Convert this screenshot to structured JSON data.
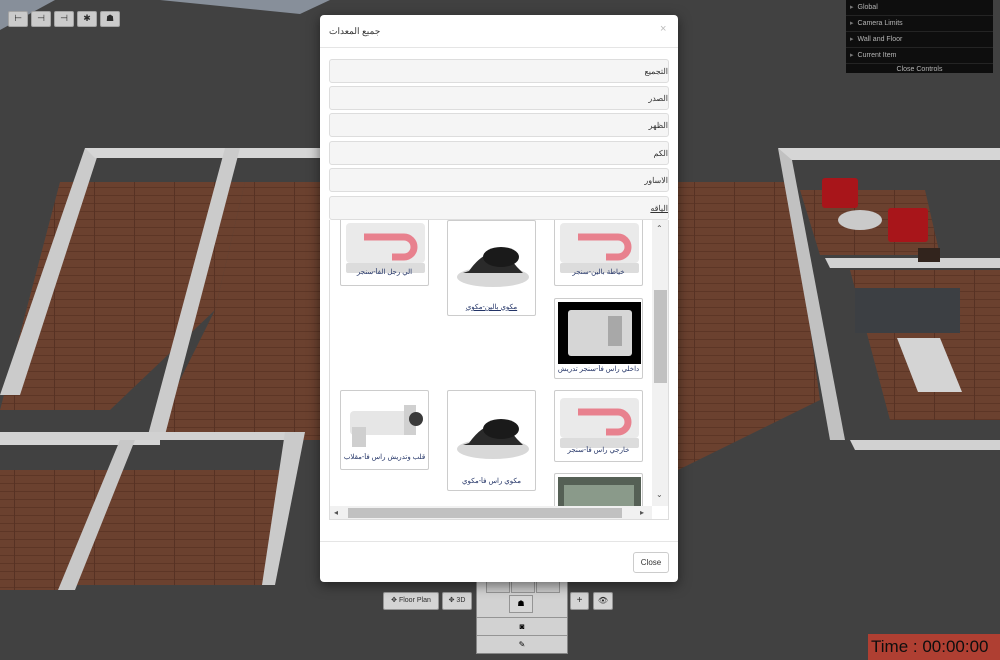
{
  "toolbar": {
    "tools": [
      {
        "glyph": "⊢"
      },
      {
        "glyph": "⊣"
      },
      {
        "glyph": "⊣"
      },
      {
        "glyph": "✱"
      },
      {
        "glyph": "☗"
      }
    ]
  },
  "controls": {
    "items": [
      "Global",
      "Camera Limits",
      "Wall and Floor",
      "Current Item"
    ],
    "close_label": "Close Controls"
  },
  "bottom_bar": {
    "floor_plan_label": "✥ Floor Plan",
    "view_3d_label": "✥ 3D",
    "zoom_in_glyph": "+",
    "eye_glyph": "👁"
  },
  "timer": {
    "text": "Time : 00:00:00"
  },
  "modal": {
    "title": "جميع المعدات",
    "close_x": "×",
    "sections": [
      "التجميع",
      "الصدر",
      "الظهر",
      "الكم",
      "الاساور",
      "الياقه"
    ],
    "items": [
      {
        "caption": "خياطة بالين-سنجر"
      },
      {
        "caption": "مكوي بالين-مكوي"
      },
      {
        "caption": "الي رجل الفأ-سنجر"
      },
      {
        "caption": "داخلي راس فأ-سنجر تدريش"
      },
      {
        "caption": "خارجي راس فأ-سنجر"
      },
      {
        "caption": "مكوي راس فأ-مكوي"
      },
      {
        "caption": "قلب وتدريش راس فأ-مقلاب"
      },
      {
        "caption": ""
      }
    ],
    "close_button_label": "Close"
  },
  "colors": {
    "accent_pink": "#e8818e",
    "timer_red": "#c8483a",
    "armchair_red": "#c0181e"
  }
}
